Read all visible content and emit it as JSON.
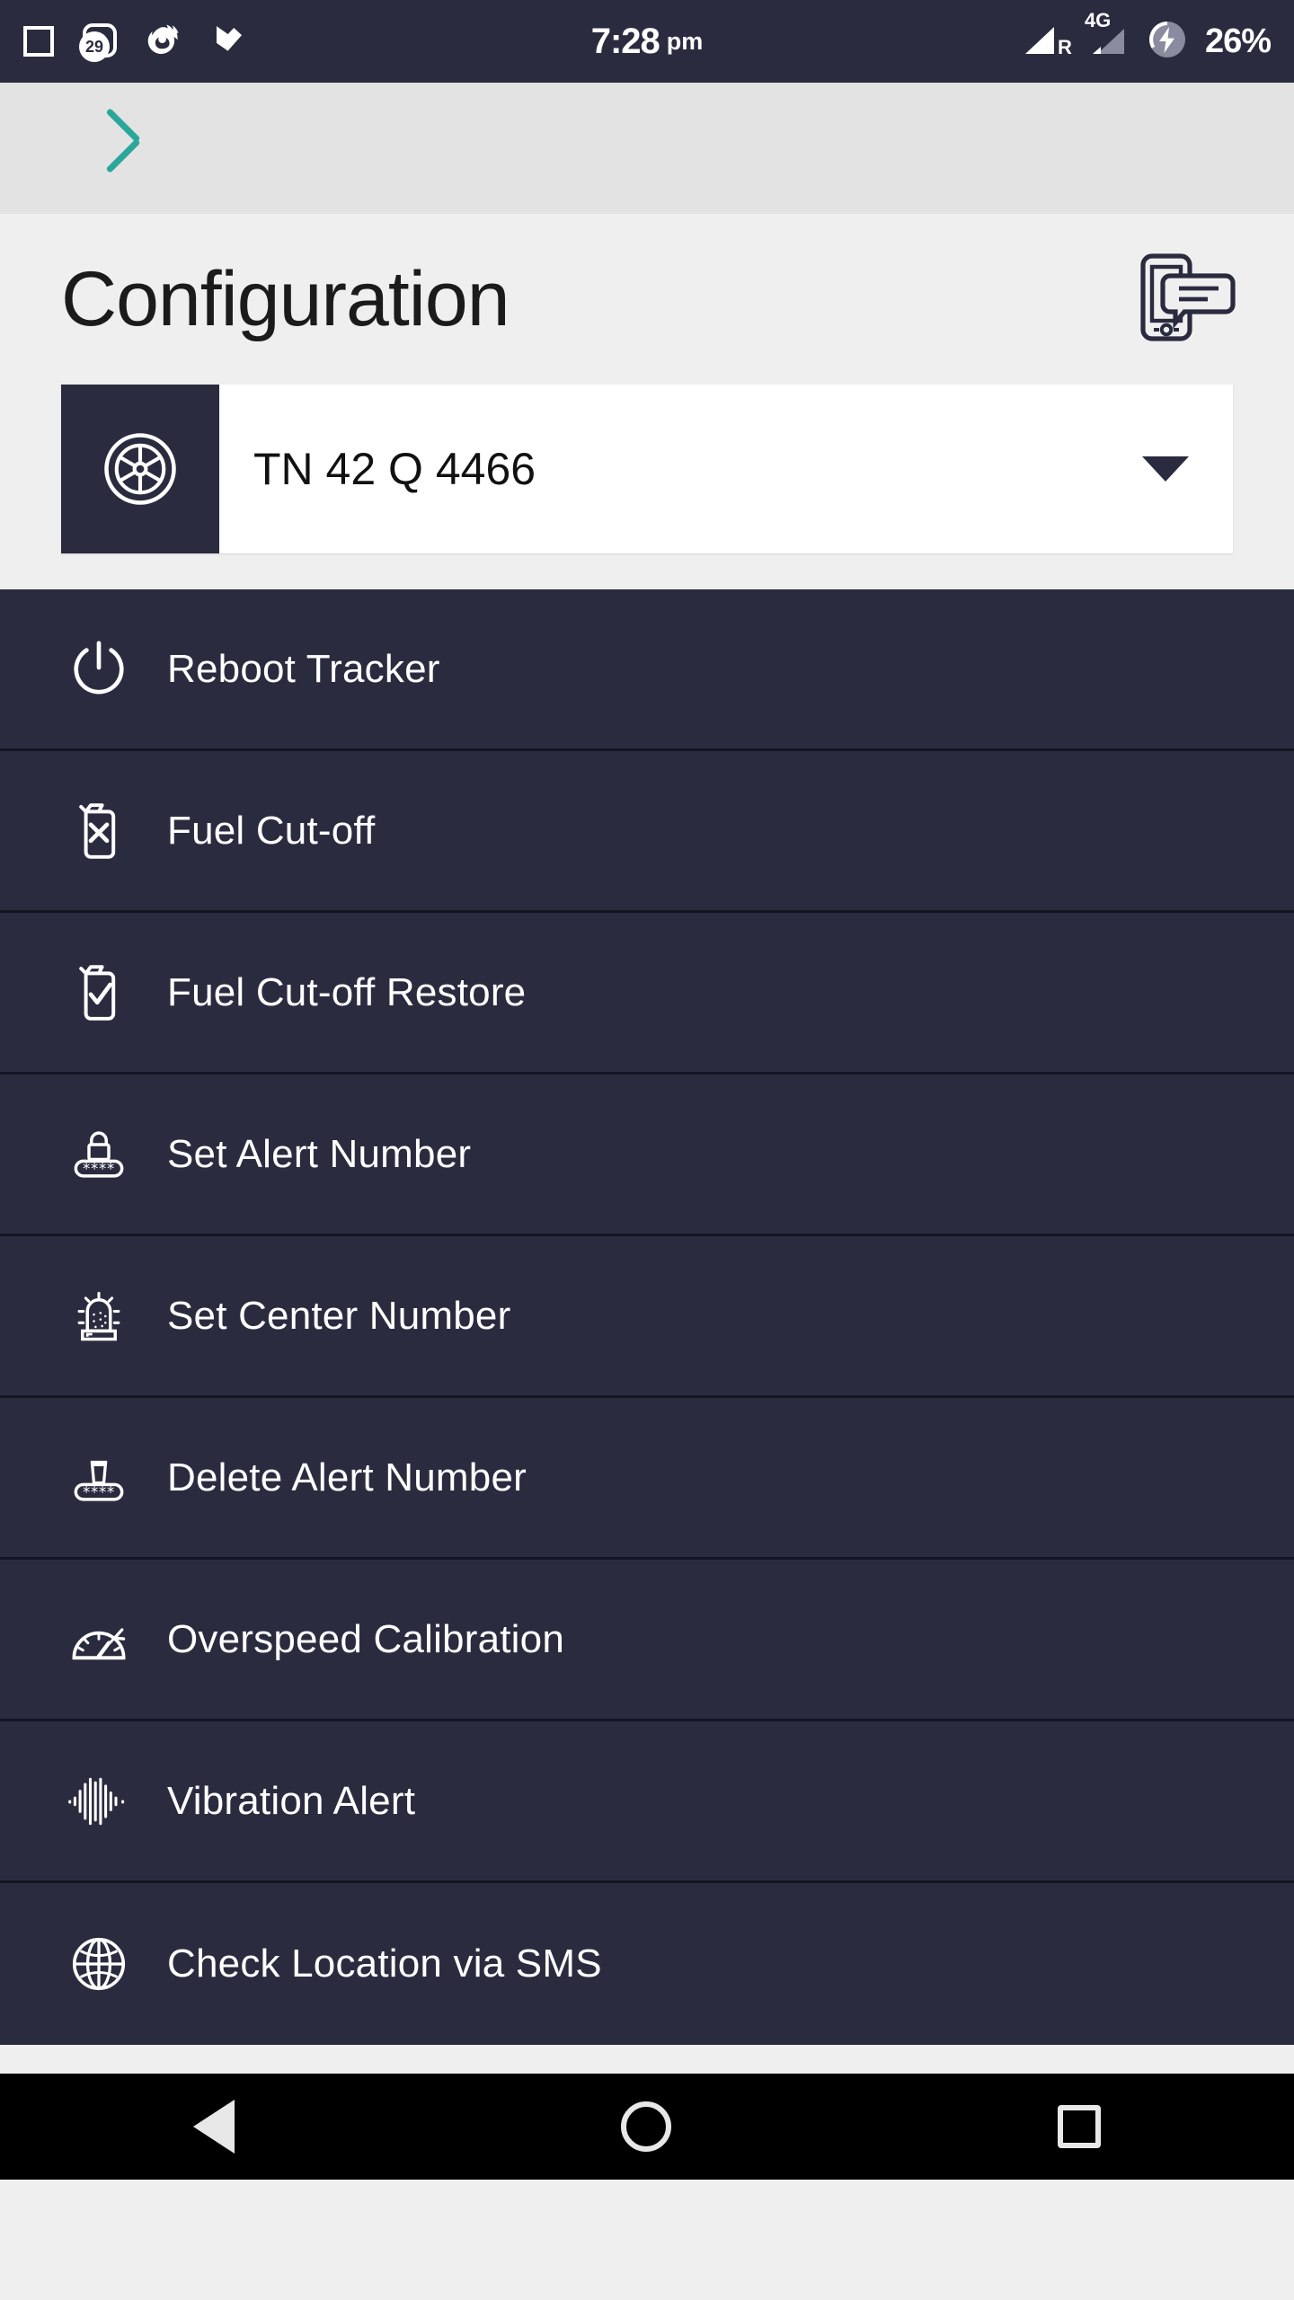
{
  "status_bar": {
    "time": "7:28",
    "ampm": "pm",
    "battery": "26%",
    "network_type": "4G",
    "roaming_label": "R",
    "notification_badge": "29",
    "icons": [
      "stop-square-icon",
      "notification-badge-icon",
      "firefox-icon",
      "checkmark-play-icon",
      "signal-bars-icon",
      "signal-bars-secondary-icon",
      "battery-charging-icon"
    ]
  },
  "app_bar": {
    "back_icon": "back-chevron-icon",
    "accent_color": "#2aa79b"
  },
  "header": {
    "title": "Configuration",
    "action_icon": "phone-sms-icon"
  },
  "vehicle_selector": {
    "icon": "wheel-icon",
    "value": "TN 42 Q 4466",
    "caret_icon": "chevron-down-icon"
  },
  "menu": {
    "items": [
      {
        "label": "Reboot Tracker",
        "icon": "power-icon"
      },
      {
        "label": "Fuel Cut-off",
        "icon": "fuel-can-x-icon"
      },
      {
        "label": "Fuel Cut-off Restore",
        "icon": "fuel-can-check-icon"
      },
      {
        "label": "Set Alert Number",
        "icon": "lock-password-icon"
      },
      {
        "label": "Set Center Number",
        "icon": "siren-icon"
      },
      {
        "label": "Delete Alert Number",
        "icon": "trash-password-icon"
      },
      {
        "label": "Overspeed Calibration",
        "icon": "speedometer-icon"
      },
      {
        "label": "Vibration Alert",
        "icon": "waveform-icon"
      },
      {
        "label": "Check Location via SMS",
        "icon": "globe-icon"
      }
    ]
  },
  "nav_bar": {
    "back": "nav-back-icon",
    "home": "nav-home-icon",
    "recents": "nav-recents-icon"
  },
  "colors": {
    "dark_navy": "#2b2b40",
    "separator": "#151521",
    "page_bg": "#efefef",
    "appbar_bg": "#e3e3e3",
    "accent_teal": "#2aa79b"
  }
}
